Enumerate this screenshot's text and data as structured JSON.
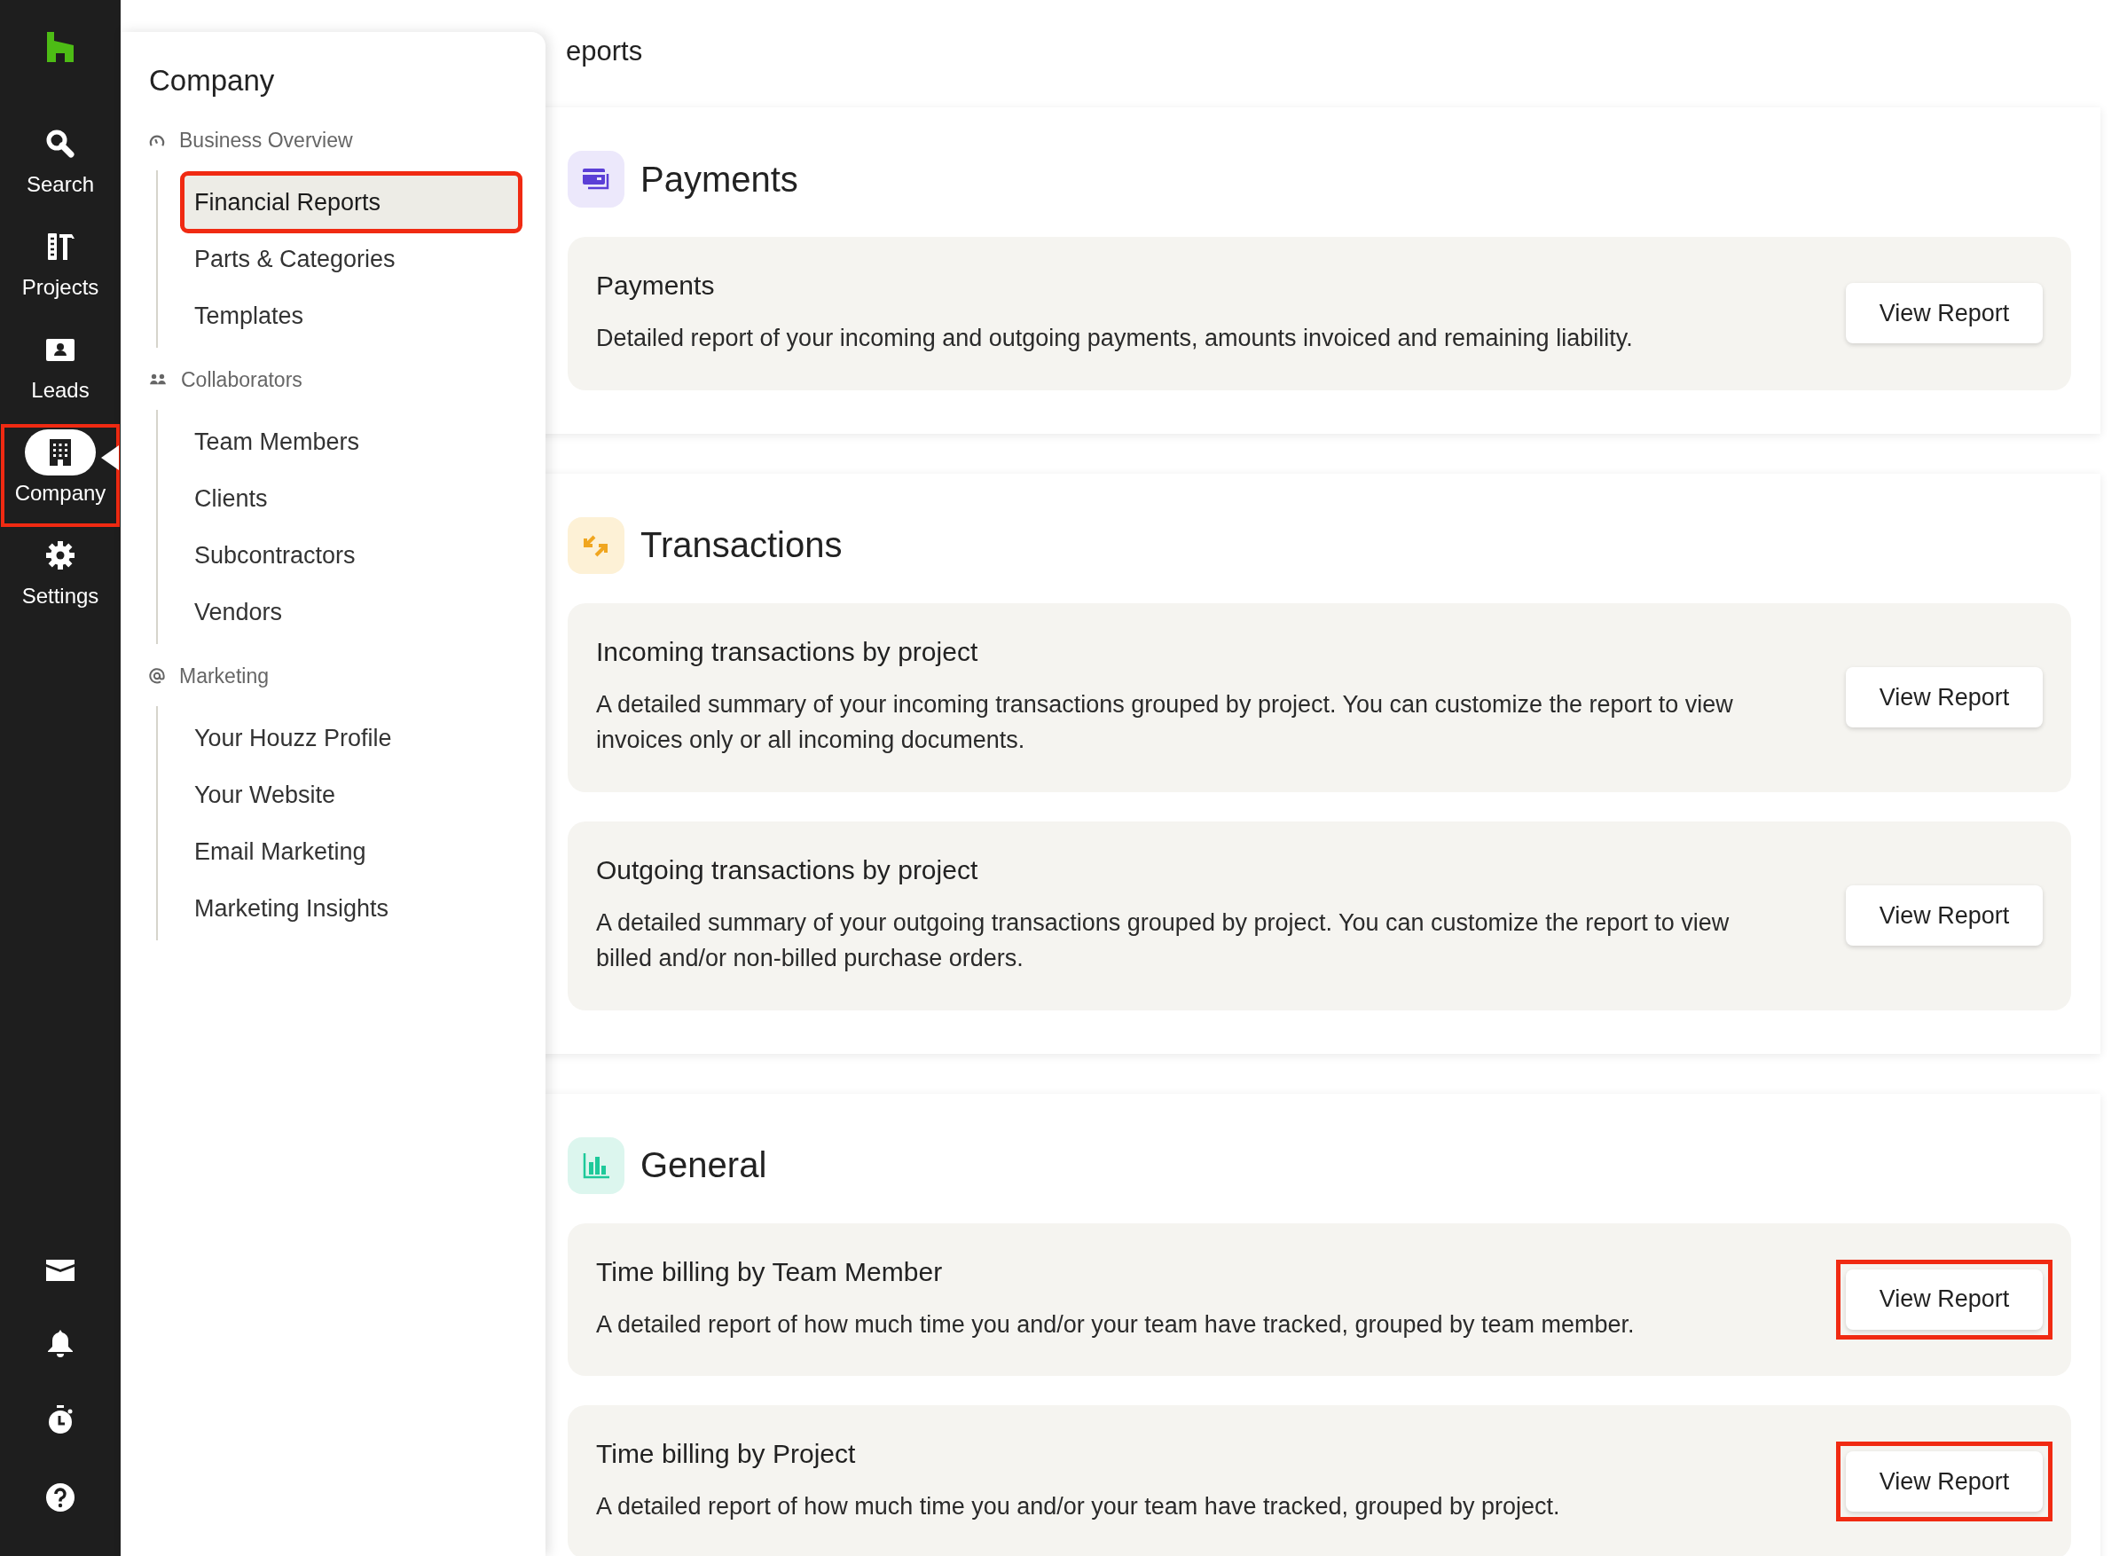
{
  "rail": {
    "items": [
      {
        "label": "Search",
        "selected": false,
        "highlighted": false
      },
      {
        "label": "Projects",
        "selected": false,
        "highlighted": false
      },
      {
        "label": "Leads",
        "selected": false,
        "highlighted": false
      },
      {
        "label": "Company",
        "selected": true,
        "highlighted": true
      },
      {
        "label": "Settings",
        "selected": false,
        "highlighted": false
      }
    ]
  },
  "submenu": {
    "title": "Company",
    "groups": [
      {
        "label": "Business Overview",
        "items": [
          {
            "label": "Financial Reports",
            "selected": true,
            "highlighted": true
          },
          {
            "label": "Parts & Categories",
            "selected": false,
            "highlighted": false
          },
          {
            "label": "Templates",
            "selected": false,
            "highlighted": false
          }
        ]
      },
      {
        "label": "Collaborators",
        "items": [
          {
            "label": "Team Members",
            "selected": false,
            "highlighted": false
          },
          {
            "label": "Clients",
            "selected": false,
            "highlighted": false
          },
          {
            "label": "Subcontractors",
            "selected": false,
            "highlighted": false
          },
          {
            "label": "Vendors",
            "selected": false,
            "highlighted": false
          }
        ]
      },
      {
        "label": "Marketing",
        "items": [
          {
            "label": "Your Houzz Profile",
            "selected": false,
            "highlighted": false
          },
          {
            "label": "Your Website",
            "selected": false,
            "highlighted": false
          },
          {
            "label": "Email Marketing",
            "selected": false,
            "highlighted": false
          },
          {
            "label": "Marketing Insights",
            "selected": false,
            "highlighted": false
          }
        ]
      }
    ]
  },
  "page_title": "eports",
  "sections": [
    {
      "title": "Payments",
      "reports": [
        {
          "title": "Payments",
          "description": "Detailed report of your incoming and outgoing payments, amounts invoiced and remaining liability.",
          "button": "View Report",
          "highlighted": false
        }
      ]
    },
    {
      "title": "Transactions",
      "reports": [
        {
          "title": "Incoming transactions by project",
          "description": "A detailed summary of your incoming transactions grouped by project. You can customize the report to view invoices only or all incoming documents.",
          "button": "View Report",
          "highlighted": false
        },
        {
          "title": "Outgoing transactions by project",
          "description": "A detailed summary of your outgoing transactions grouped by project. You can customize the report to view billed and/or non-billed purchase orders.",
          "button": "View Report",
          "highlighted": false
        }
      ]
    },
    {
      "title": "General",
      "reports": [
        {
          "title": "Time billing by Team Member",
          "description": "A detailed report of how much time you and/or your team have tracked, grouped by team member.",
          "button": "View Report",
          "highlighted": true
        },
        {
          "title": "Time billing by Project",
          "description": "A detailed report of how much time you and/or your team have tracked, grouped by project.",
          "button": "View Report",
          "highlighted": true
        }
      ]
    }
  ]
}
